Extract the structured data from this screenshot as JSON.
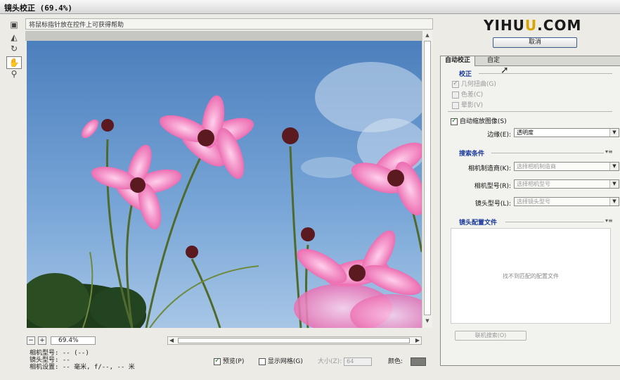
{
  "window": {
    "title": "镜头校正 (69.4%)"
  },
  "tools": [
    {
      "icon": "remove-distortion-icon"
    },
    {
      "icon": "straighten-icon"
    },
    {
      "icon": "move-grid-icon"
    },
    {
      "icon": "hand-icon"
    },
    {
      "icon": "zoom-icon"
    }
  ],
  "help_text": "将鼠标指针放在控件上可获得帮助",
  "zoom": {
    "minus": "−",
    "plus": "+",
    "value": "69.4%"
  },
  "camera_info": {
    "line1": "相机型号: -- (--)",
    "line2": "镜头型号: --",
    "line3": "相机设置: -- 毫米, f/--, -- 米"
  },
  "bottom": {
    "preview_label": "预览(P)",
    "grid_label": "显示网格(G)",
    "size_label": "大小(Z):",
    "size_value": "64",
    "color_label": "颜色:"
  },
  "logo": {
    "part1": "YI",
    "part2": "HU",
    "part3": "U",
    "part4": ".COM"
  },
  "cancel_label": "取消",
  "panel": {
    "tabs": [
      "自动校正",
      "自定"
    ],
    "correction": {
      "heading": "校正",
      "opts": [
        "几何扭曲(G)",
        "色差(C)",
        "晕影(V)"
      ]
    },
    "auto_scale_label": "自动缩放图像(S)",
    "edge_label": "边缘(E):",
    "edge_value": "透明度",
    "search": {
      "heading": "搜索条件",
      "maker_label": "相机制造商(K):",
      "maker_placeholder": "选择相机制造商",
      "model_label": "相机型号(R):",
      "model_placeholder": "选择相机型号",
      "lens_label": "镜头型号(L):",
      "lens_placeholder": "选择镜头型号"
    },
    "profiles": {
      "heading": "镜头配置文件",
      "empty_text": "找不到匹配的配置文件"
    },
    "online_search_label": "联机搜索(O)"
  }
}
